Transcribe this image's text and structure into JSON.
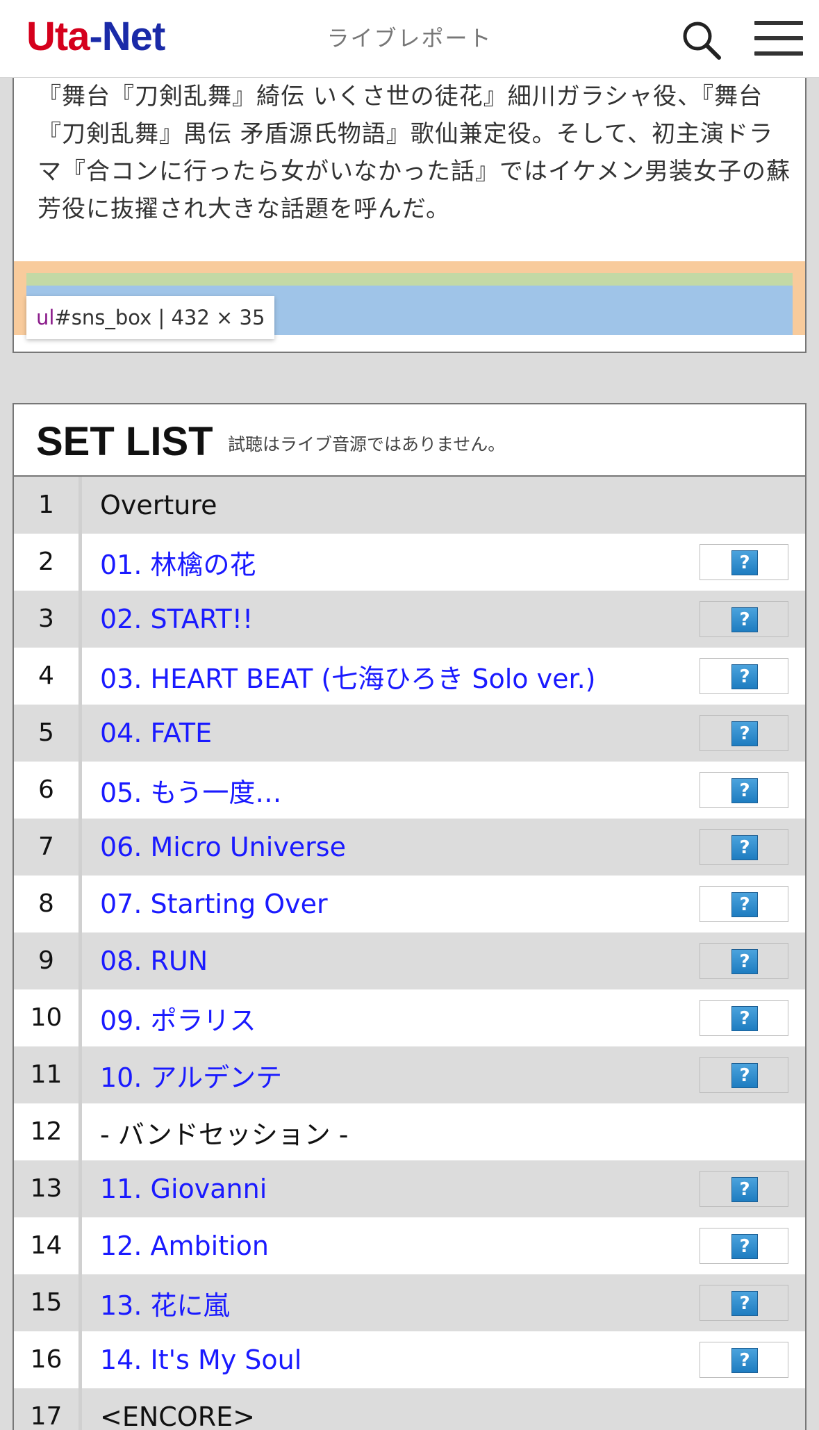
{
  "header": {
    "logo_uta": "Uta",
    "logo_dash": "-",
    "logo_net": "Net",
    "title": "ライブレポート",
    "icons": [
      "search-icon",
      "menu-icon"
    ]
  },
  "intro": {
    "text": "『舞台『刀剣乱舞』綺伝 いくさ世の徒花』細川ガラシャ役、『舞台『刀剣乱舞』禺伝 矛盾源氏物語』歌仙兼定役。そして、初主演ドラマ『合コンに行ったら女がいなかった話』ではイケメン男装女子の蘇芳役に抜擢され大きな話題を呼んだ。"
  },
  "devtools": {
    "tag": "ul",
    "selector": "#sns_box",
    "size": " | 432 × 35"
  },
  "setlist": {
    "title": "SET LIST",
    "note": "試聴はライブ音源ではありません。",
    "listen_icon": "?",
    "rows": [
      {
        "num": "1",
        "title": "Overture",
        "link": false
      },
      {
        "num": "2",
        "title": "01. 林檎の花",
        "link": true
      },
      {
        "num": "3",
        "title": "02. START!!",
        "link": true
      },
      {
        "num": "4",
        "title": "03. HEART BEAT (七海ひろき Solo ver.)",
        "link": true
      },
      {
        "num": "5",
        "title": "04. FATE",
        "link": true
      },
      {
        "num": "6",
        "title": "05. もう一度…",
        "link": true
      },
      {
        "num": "7",
        "title": "06. Micro Universe",
        "link": true
      },
      {
        "num": "8",
        "title": "07. Starting Over",
        "link": true
      },
      {
        "num": "9",
        "title": "08. RUN",
        "link": true
      },
      {
        "num": "10",
        "title": "09. ポラリス",
        "link": true
      },
      {
        "num": "11",
        "title": "10. アルデンテ",
        "link": true
      },
      {
        "num": "12",
        "title": "- バンドセッション -",
        "link": false
      },
      {
        "num": "13",
        "title": "11. Giovanni",
        "link": true
      },
      {
        "num": "14",
        "title": "12. Ambition",
        "link": true
      },
      {
        "num": "15",
        "title": "13. 花に嵐",
        "link": true
      },
      {
        "num": "16",
        "title": "14. It's My Soul",
        "link": true
      },
      {
        "num": "17",
        "title": "<ENCORE>",
        "link": false
      }
    ]
  },
  "colors": {
    "brand_red": "#d5001c",
    "brand_blue": "#1a2aa8",
    "link": "#1a1aff"
  }
}
